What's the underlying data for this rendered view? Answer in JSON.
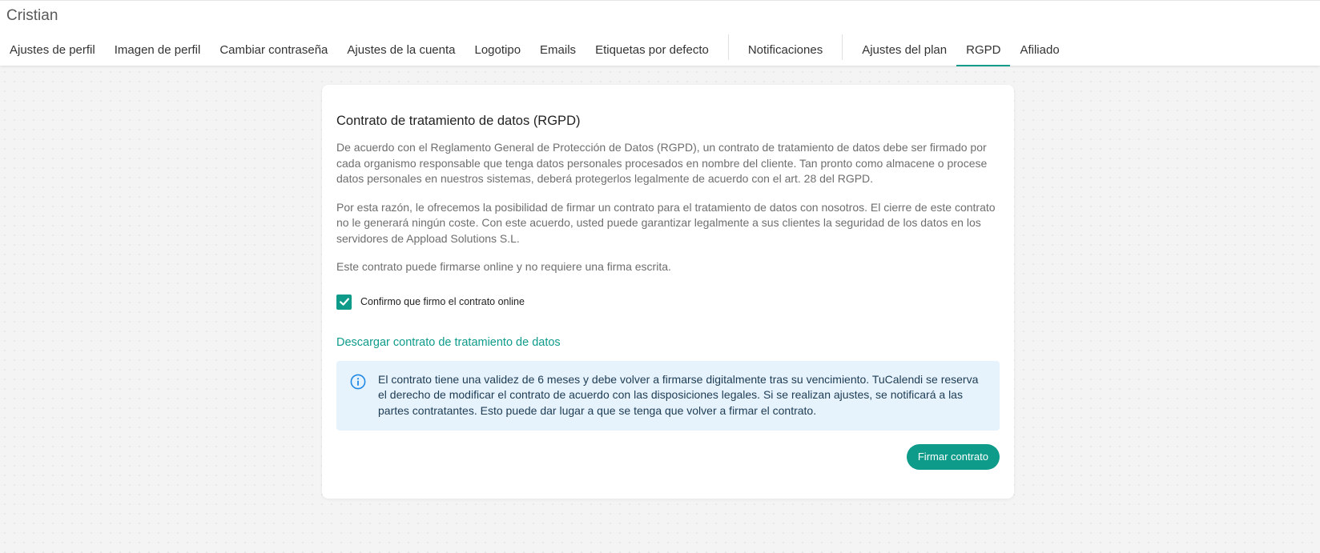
{
  "header": {
    "user_name": "Cristian",
    "tabs": [
      {
        "label": "Ajustes de perfil"
      },
      {
        "label": "Imagen de perfil"
      },
      {
        "label": "Cambiar contraseña"
      },
      {
        "label": "Ajustes de la cuenta"
      },
      {
        "label": "Logotipo"
      },
      {
        "label": "Emails"
      },
      {
        "label": "Etiquetas por defecto"
      },
      {
        "label": "Notificaciones"
      },
      {
        "label": "Ajustes del plan"
      },
      {
        "label": "RGPD"
      },
      {
        "label": "Afiliado"
      }
    ],
    "active_tab": "RGPD"
  },
  "gdpr": {
    "title": "Contrato de tratamiento de datos (RGPD)",
    "paragraphs": [
      "De acuerdo con el Reglamento General de Protección de Datos (RGPD), un contrato de tratamiento de datos debe ser firmado por cada organismo responsable que tenga datos personales procesados en nombre del cliente. Tan pronto como almacene o procese datos personales en nuestros sistemas, deberá protegerlos legalmente de acuerdo con el art. 28 del RGPD.",
      "Por esta razón, le ofrecemos la posibilidad de firmar un contrato para el tratamiento de datos con nosotros. El cierre de este contrato no le generará ningún coste. Con este acuerdo, usted puede garantizar legalmente a sus clientes la seguridad de los datos en los servidores de Appload Solutions S.L.",
      "Este contrato puede firmarse online y no requiere una firma escrita."
    ],
    "confirm_label": "Confirmo que firmo el contrato online",
    "confirm_checked": true,
    "download_link": "Descargar contrato de tratamiento de datos",
    "info_text": "El contrato tiene una validez de 6 meses y debe volver a firmarse digitalmente tras su vencimiento. TuCalendi se reserva el derecho de modificar el contrato de acuerdo con las disposiciones legales. Si se realizan ajustes, se notificará a las partes contratantes. Esto puede dar lugar a que se tenga que volver a firmar el contrato.",
    "sign_button": "Firmar contrato"
  },
  "icons": {
    "check": "check-icon",
    "info": "info-circle-icon"
  },
  "colors": {
    "accent": "#0e9b8a",
    "info_bg": "#e6f3fd",
    "info_icon": "#1e88e5"
  }
}
